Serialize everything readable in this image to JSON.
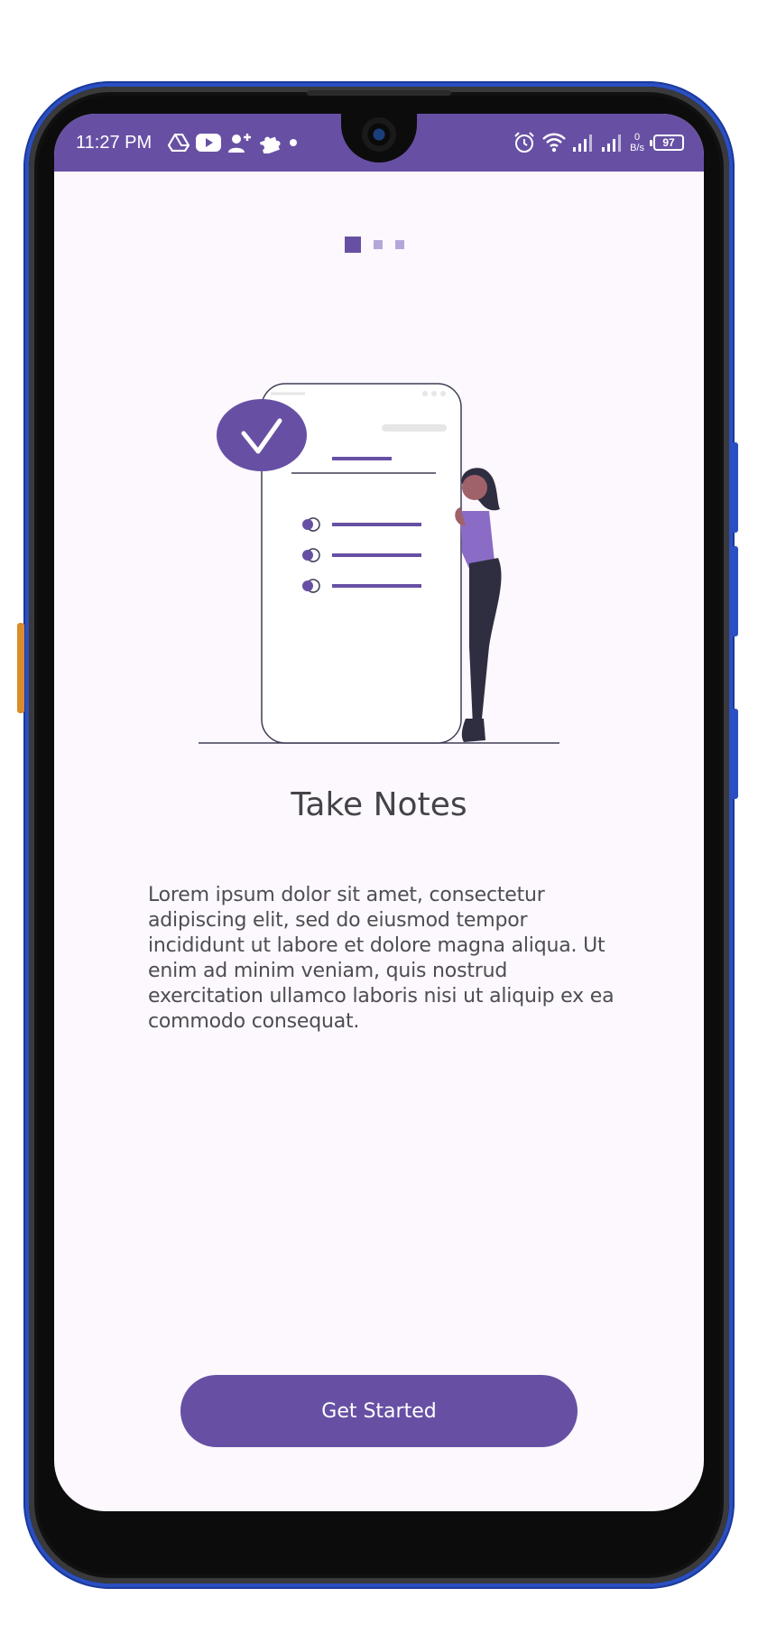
{
  "status_bar": {
    "time": "11:27 PM",
    "notification_icons": [
      "drive-icon",
      "youtube-icon",
      "person-add-icon",
      "puzzle-icon",
      "dot-icon"
    ],
    "system_icons": [
      "alarm-icon",
      "wifi-icon",
      "signal-icon",
      "signal-icon"
    ],
    "net_speed_value": "0",
    "net_speed_unit": "B/s",
    "battery_level": "97"
  },
  "onboarding": {
    "page_count": 3,
    "active_page": 1,
    "title": "Take Notes",
    "description": "Lorem ipsum dolor sit amet, consectetur adipiscing elit, sed do eiusmod tempor incididunt ut labore et dolore magna aliqua. Ut enim ad minim veniam, quis nostrud exercitation ullamco laboris nisi ut aliquip ex ea commodo consequat.",
    "button_label": "Get Started"
  },
  "colors": {
    "primary": "#6750a4",
    "indicator_inactive": "#b5a6d9",
    "background": "#fdf8fd",
    "title_text": "#444448",
    "body_text": "#4d4d52"
  }
}
